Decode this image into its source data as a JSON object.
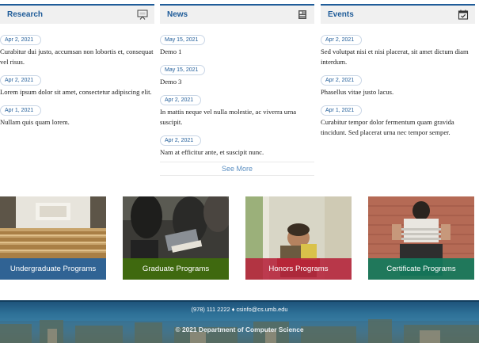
{
  "columns": [
    {
      "title": "Research",
      "icon": "presentation-board-icon",
      "items": [
        {
          "date": "Apr 2, 2021",
          "text": "Curabitur dui justo, accumsan non lobortis et, consequat vel risus."
        },
        {
          "date": "Apr 2, 2021",
          "text": "Lorem ipsum dolor sit amet, consectetur adipiscing elit."
        },
        {
          "date": "Apr 1, 2021",
          "text": "Nullam quis quam lorem."
        }
      ]
    },
    {
      "title": "News",
      "icon": "newspaper-icon",
      "items": [
        {
          "date": "May 15, 2021",
          "text": "Demo 1"
        },
        {
          "date": "May 15, 2021",
          "text": "Demo 3"
        },
        {
          "date": "Apr 2, 2021",
          "text": "In mattis neque vel nulla molestie, ac viverra urna suscipit."
        },
        {
          "date": "Apr 2, 2021",
          "text": "Nam at efficitur ante, et suscipit nunc."
        }
      ],
      "see_more": "See More"
    },
    {
      "title": "Events",
      "icon": "calendar-check-icon",
      "items": [
        {
          "date": "Apr 2, 2021",
          "text": "Sed volutpat nisi et nisi placerat, sit amet dictum diam interdum."
        },
        {
          "date": "Apr 2, 2021",
          "text": "Phasellus vitae justo lacus."
        },
        {
          "date": "Apr 1, 2021",
          "text": "Curabitur tempor dolor fermentum quam gravida tincidunt. Sed placerat urna nec tempor semper."
        }
      ]
    }
  ],
  "programs": [
    {
      "label": "Undergraduate Programs",
      "color": "#1f5c99"
    },
    {
      "label": "Graduate Programs",
      "color": "#3f6b0e"
    },
    {
      "label": "Honors Programs",
      "color": "#b5223a"
    },
    {
      "label": "Certificate Programs",
      "color": "#137a5c"
    }
  ],
  "footer": {
    "contact": "(978) 111 2222 ♦ csinfo@cs.umb.edu",
    "copyright": "© 2021 Department of Computer Science"
  },
  "colors": {
    "accent": "#1f5c99",
    "header_bg": "#f0f0f0",
    "link": "#5b8fc2"
  }
}
